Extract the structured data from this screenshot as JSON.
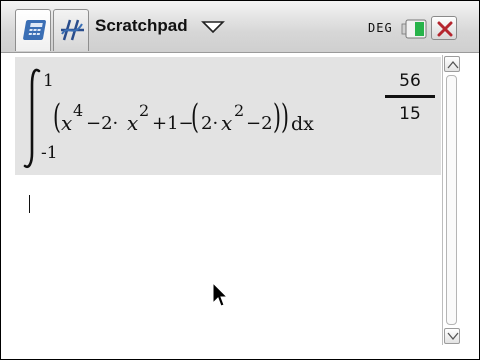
{
  "app": {
    "document_title": "Scratchpad",
    "angle_mode": "DEG"
  },
  "tabs": [
    {
      "name": "calculator",
      "icon": "calculator-icon",
      "active": true
    },
    {
      "name": "graphs",
      "icon": "graph-icon",
      "active": false
    }
  ],
  "history": {
    "expression": {
      "integral_upper": "1",
      "integral_lower": "-1",
      "integrand_parts": [
        "(",
        "x",
        "4",
        "−2·",
        "x",
        "2",
        "+1−",
        "(",
        "2·",
        "x",
        "2",
        "−2",
        "))",
        "dx"
      ]
    },
    "result": {
      "numerator": "56",
      "denominator": "15"
    }
  },
  "colors": {
    "battery_fill": "#27b34a",
    "close_x": "#b5262e",
    "entry_bg": "#e3e3e3"
  }
}
